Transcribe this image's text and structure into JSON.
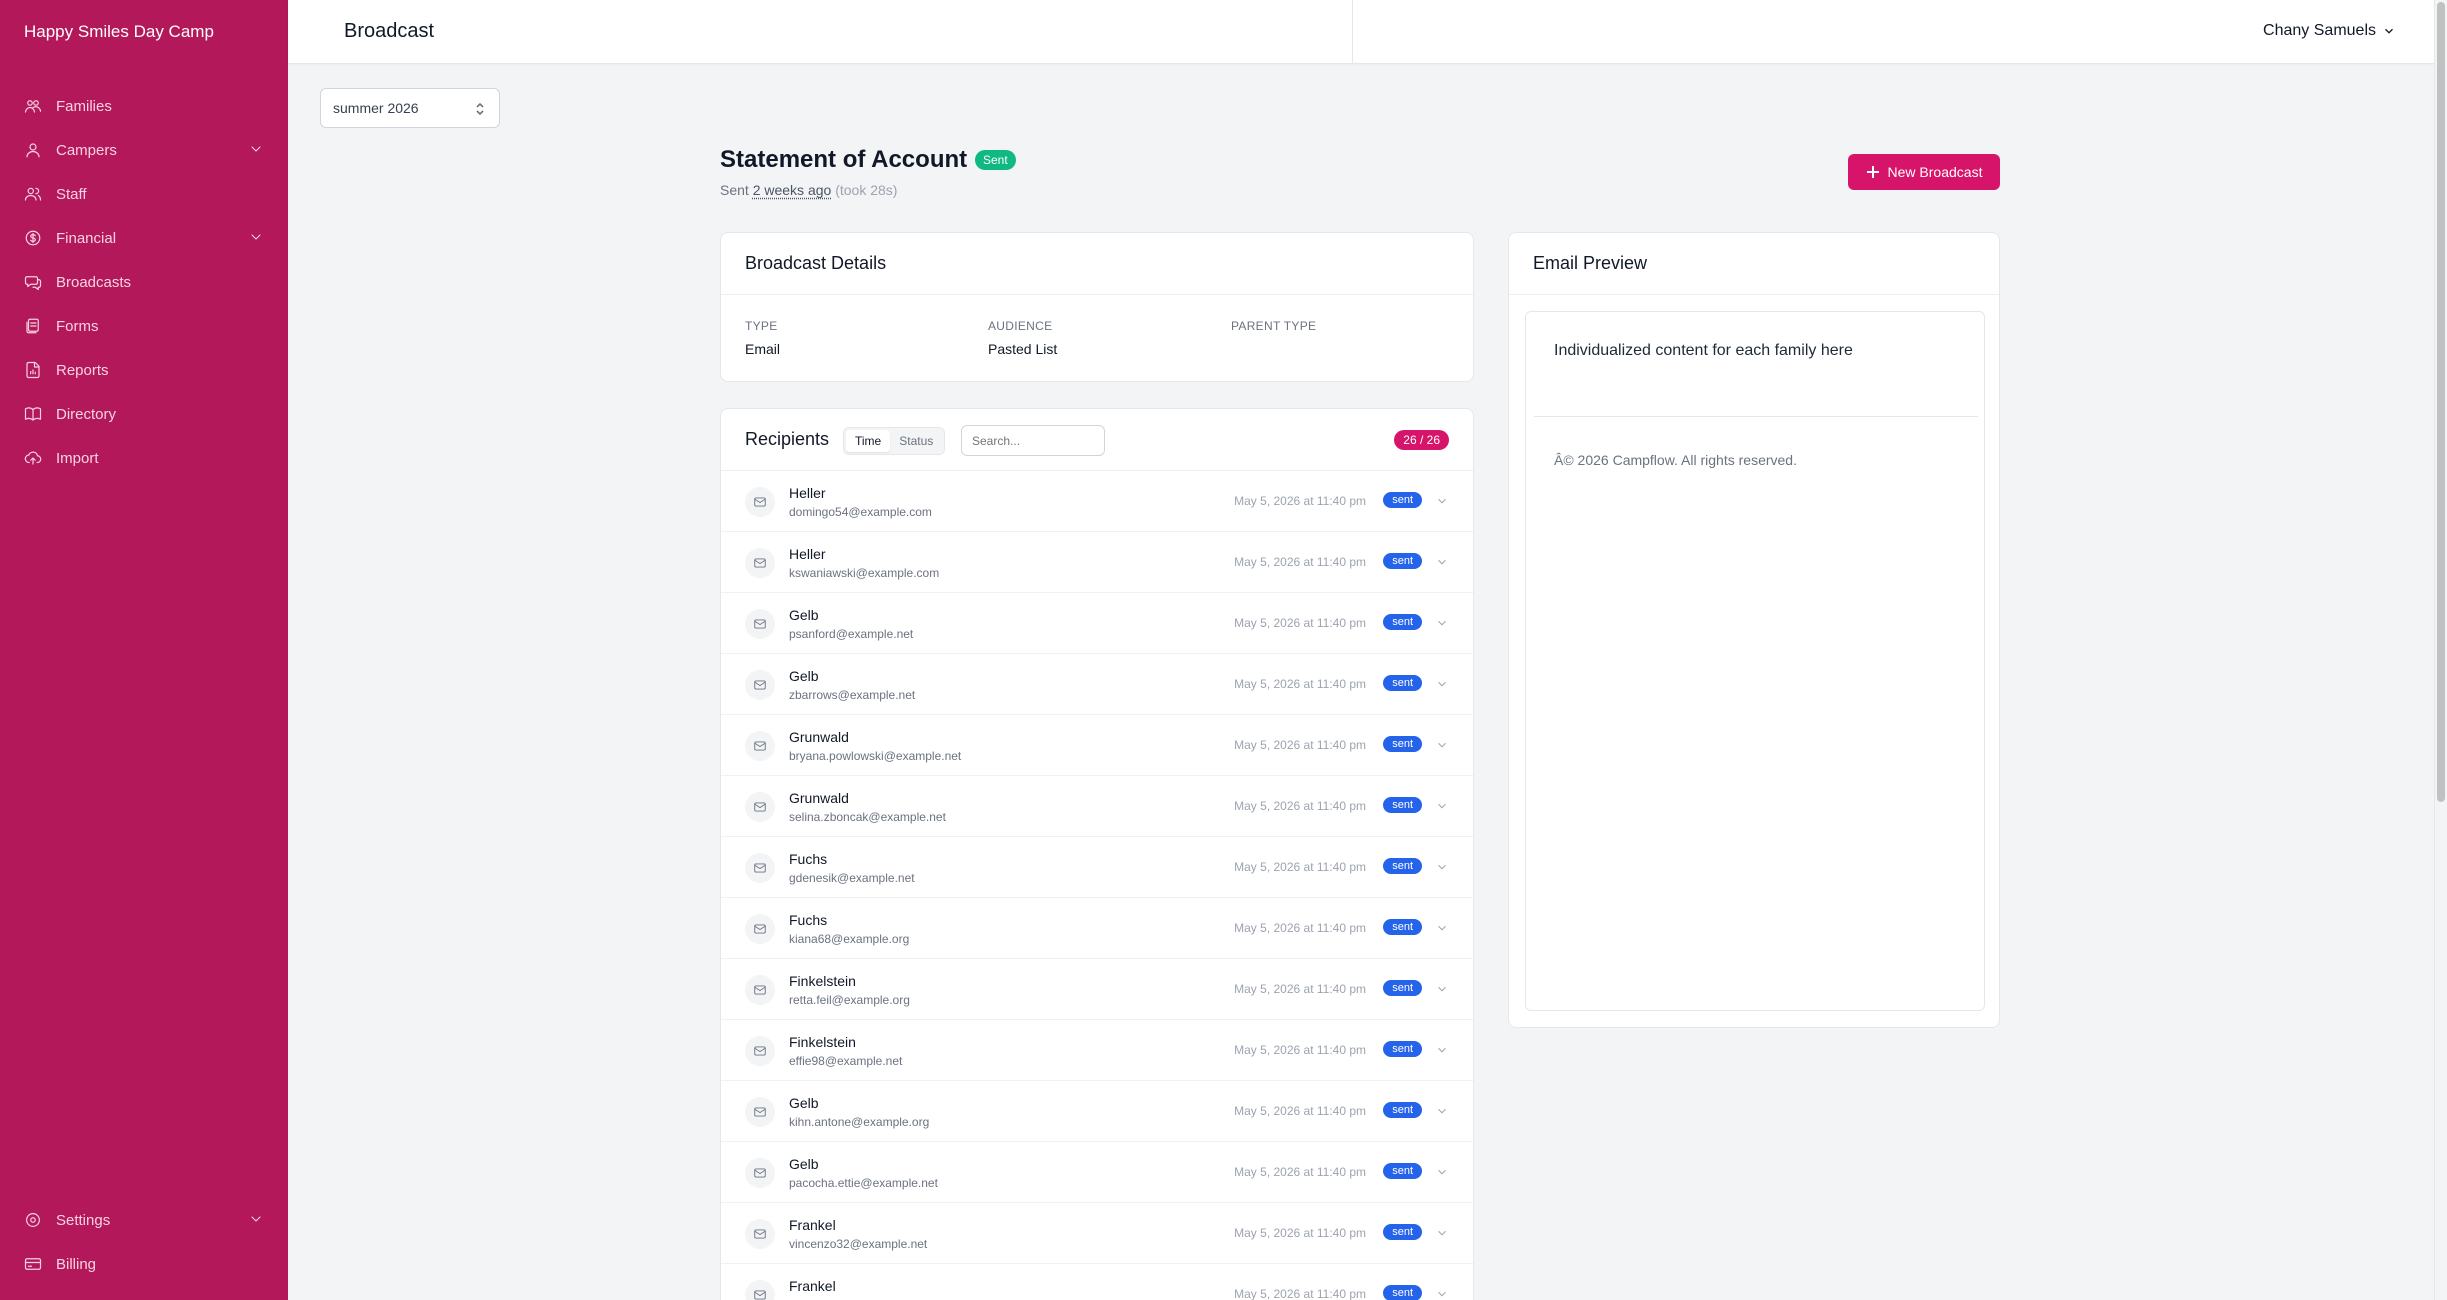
{
  "app": {
    "brand": "Happy Smiles Day Camp"
  },
  "sidebar": {
    "items": [
      {
        "label": "Families",
        "icon": "families-icon"
      },
      {
        "label": "Campers",
        "icon": "user-icon",
        "expandable": true
      },
      {
        "label": "Staff",
        "icon": "users-icon"
      },
      {
        "label": "Financial",
        "icon": "dollar-icon",
        "expandable": true
      },
      {
        "label": "Broadcasts",
        "icon": "chat-icon"
      },
      {
        "label": "Forms",
        "icon": "forms-icon"
      },
      {
        "label": "Reports",
        "icon": "report-icon"
      },
      {
        "label": "Directory",
        "icon": "book-icon"
      },
      {
        "label": "Import",
        "icon": "cloud-upload-icon"
      }
    ],
    "bottom_items": [
      {
        "label": "Settings",
        "icon": "gear-icon",
        "expandable": true
      },
      {
        "label": "Billing",
        "icon": "card-icon"
      }
    ]
  },
  "topbar": {
    "title": "Broadcast",
    "user": "Chany Samuels"
  },
  "season": {
    "selected": "summer 2026"
  },
  "broadcast": {
    "title": "Statement of Account",
    "status_badge": "Sent",
    "sent_prefix": "Sent",
    "sent_ago": "2 weeks ago",
    "took": "(took 28s)",
    "new_button": "New Broadcast"
  },
  "details": {
    "heading": "Broadcast Details",
    "type_label": "TYPE",
    "type_value": "Email",
    "audience_label": "AUDIENCE",
    "audience_value": "Pasted List",
    "parent_type_label": "PARENT TYPE",
    "parent_type_value": ""
  },
  "recipients": {
    "heading": "Recipients",
    "sort_options": [
      "Time",
      "Status"
    ],
    "sort_active": "Time",
    "search_placeholder": "Search...",
    "count": "26 / 26",
    "rows": [
      {
        "name": "Heller",
        "email": "domingo54@example.com",
        "time": "May 5, 2026 at 11:40 pm",
        "status": "sent"
      },
      {
        "name": "Heller",
        "email": "kswaniawski@example.com",
        "time": "May 5, 2026 at 11:40 pm",
        "status": "sent"
      },
      {
        "name": "Gelb",
        "email": "psanford@example.net",
        "time": "May 5, 2026 at 11:40 pm",
        "status": "sent"
      },
      {
        "name": "Gelb",
        "email": "zbarrows@example.net",
        "time": "May 5, 2026 at 11:40 pm",
        "status": "sent"
      },
      {
        "name": "Grunwald",
        "email": "bryana.powlowski@example.net",
        "time": "May 5, 2026 at 11:40 pm",
        "status": "sent"
      },
      {
        "name": "Grunwald",
        "email": "selina.zboncak@example.net",
        "time": "May 5, 2026 at 11:40 pm",
        "status": "sent"
      },
      {
        "name": "Fuchs",
        "email": "gdenesik@example.net",
        "time": "May 5, 2026 at 11:40 pm",
        "status": "sent"
      },
      {
        "name": "Fuchs",
        "email": "kiana68@example.org",
        "time": "May 5, 2026 at 11:40 pm",
        "status": "sent"
      },
      {
        "name": "Finkelstein",
        "email": "retta.feil@example.org",
        "time": "May 5, 2026 at 11:40 pm",
        "status": "sent"
      },
      {
        "name": "Finkelstein",
        "email": "effie98@example.net",
        "time": "May 5, 2026 at 11:40 pm",
        "status": "sent"
      },
      {
        "name": "Gelb",
        "email": "kihn.antone@example.org",
        "time": "May 5, 2026 at 11:40 pm",
        "status": "sent"
      },
      {
        "name": "Gelb",
        "email": "pacocha.ettie@example.net",
        "time": "May 5, 2026 at 11:40 pm",
        "status": "sent"
      },
      {
        "name": "Frankel",
        "email": "vincenzo32@example.net",
        "time": "May 5, 2026 at 11:40 pm",
        "status": "sent"
      },
      {
        "name": "Frankel",
        "email": "",
        "time": "May 5, 2026 at 11:40 pm",
        "status": "sent"
      }
    ]
  },
  "preview": {
    "heading": "Email Preview",
    "body": "Individualized content for each family here",
    "footer": "Â© 2026 Campflow. All rights reserved."
  },
  "colors": {
    "sidebar": "#b3185a",
    "accent": "#d6156a",
    "sent_badge": "#10b981",
    "status_blue": "#2563eb"
  }
}
